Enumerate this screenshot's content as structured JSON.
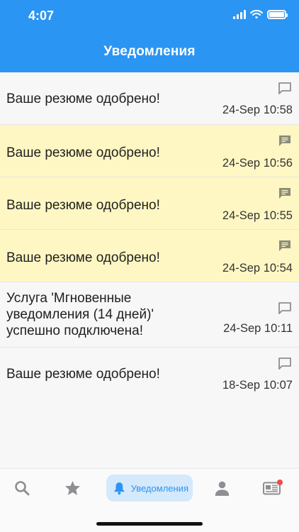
{
  "status_bar": {
    "time": "4:07"
  },
  "header": {
    "title": "Уведомления"
  },
  "notifications": [
    {
      "text": "Ваше резюме одобрено!",
      "time": "24-Sep 10:58",
      "unread": false
    },
    {
      "text": "Ваше резюме одобрено!",
      "time": "24-Sep 10:56",
      "unread": true
    },
    {
      "text": "Ваше резюме одобрено!",
      "time": "24-Sep 10:55",
      "unread": true
    },
    {
      "text": "Ваше резюме одобрено!",
      "time": "24-Sep 10:54",
      "unread": true
    },
    {
      "text_lines": [
        "Услуга 'Мгновенные",
        "уведомления (14 дней)'",
        "успешно подключена!"
      ],
      "time": "24-Sep 10:11",
      "unread": false
    },
    {
      "text": "Ваше резюме одобрено!",
      "time": "18-Sep 10:07",
      "unread": false
    }
  ],
  "tabbar": {
    "items": [
      {
        "icon": "search-icon",
        "label": ""
      },
      {
        "icon": "star-icon",
        "label": ""
      },
      {
        "icon": "bell-icon",
        "label": "Уведомления",
        "active": true
      },
      {
        "icon": "person-icon",
        "label": ""
      },
      {
        "icon": "newspaper-icon",
        "label": "",
        "badge": true
      }
    ]
  },
  "colors": {
    "primary": "#2b95f3",
    "unread_bg": "#fff7c3",
    "read_bg": "#f7f7f7",
    "badge": "#ef4b4b",
    "icon_gray": "#8e8e93"
  }
}
